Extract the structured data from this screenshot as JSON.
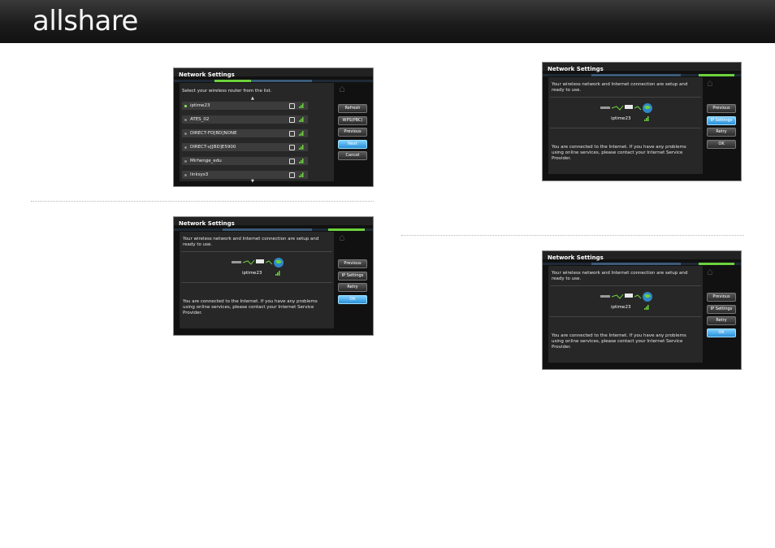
{
  "header": {
    "logo_text": "allshare"
  },
  "colors": {
    "accent_green": "#6cd23c",
    "button_blue": "#2a8fd8",
    "panel_bg": "#272727"
  },
  "screens": {
    "router_list": {
      "title": "Network Settings",
      "instruction": "Select your wireless router from the list.",
      "networks": [
        {
          "name": "iptime23",
          "selected": true
        },
        {
          "name": "ATES_02"
        },
        {
          "name": "DIRECT-FD[BD]NONE"
        },
        {
          "name": "DIRECT-vJ[BD]E5900"
        },
        {
          "name": "Mirhenge_edu"
        },
        {
          "name": "linksys3"
        }
      ],
      "buttons": [
        "Refresh",
        "WPS(PBC)",
        "Previous",
        "Next",
        "Cancel"
      ],
      "selected_button": "Next"
    },
    "connected_1": {
      "title": "Network Settings",
      "message": "Your wireless network and Internet connection are setup and ready to use.",
      "ssid": "iptime23",
      "note": "You are connected to the Internet. If you have any problems using online services, please contact your Internet Service Provider.",
      "buttons": [
        "Previous",
        "IP Settings",
        "Retry",
        "OK"
      ],
      "selected_button": "OK"
    },
    "connected_2": {
      "title": "Network Settings",
      "message": "Your wireless network and Internet connection are setup and ready to use.",
      "ssid": "iptime23",
      "note": "You are connected to the Internet. If you have any problems using online services, please contact your Internet Service Provider.",
      "buttons": [
        "Previous",
        "IP Settings",
        "Retry",
        "OK"
      ],
      "selected_button": "IP Settings"
    },
    "connected_3": {
      "title": "Network Settings",
      "message": "Your wireless network and Internet connection are setup and ready to use.",
      "ssid": "iptime23",
      "note": "You are connected to the Internet. If you have any problems using online services, please contact your Internet Service Provider.",
      "buttons": [
        "Previous",
        "IP Settings",
        "Retry",
        "OK"
      ],
      "selected_button": "OK"
    }
  }
}
